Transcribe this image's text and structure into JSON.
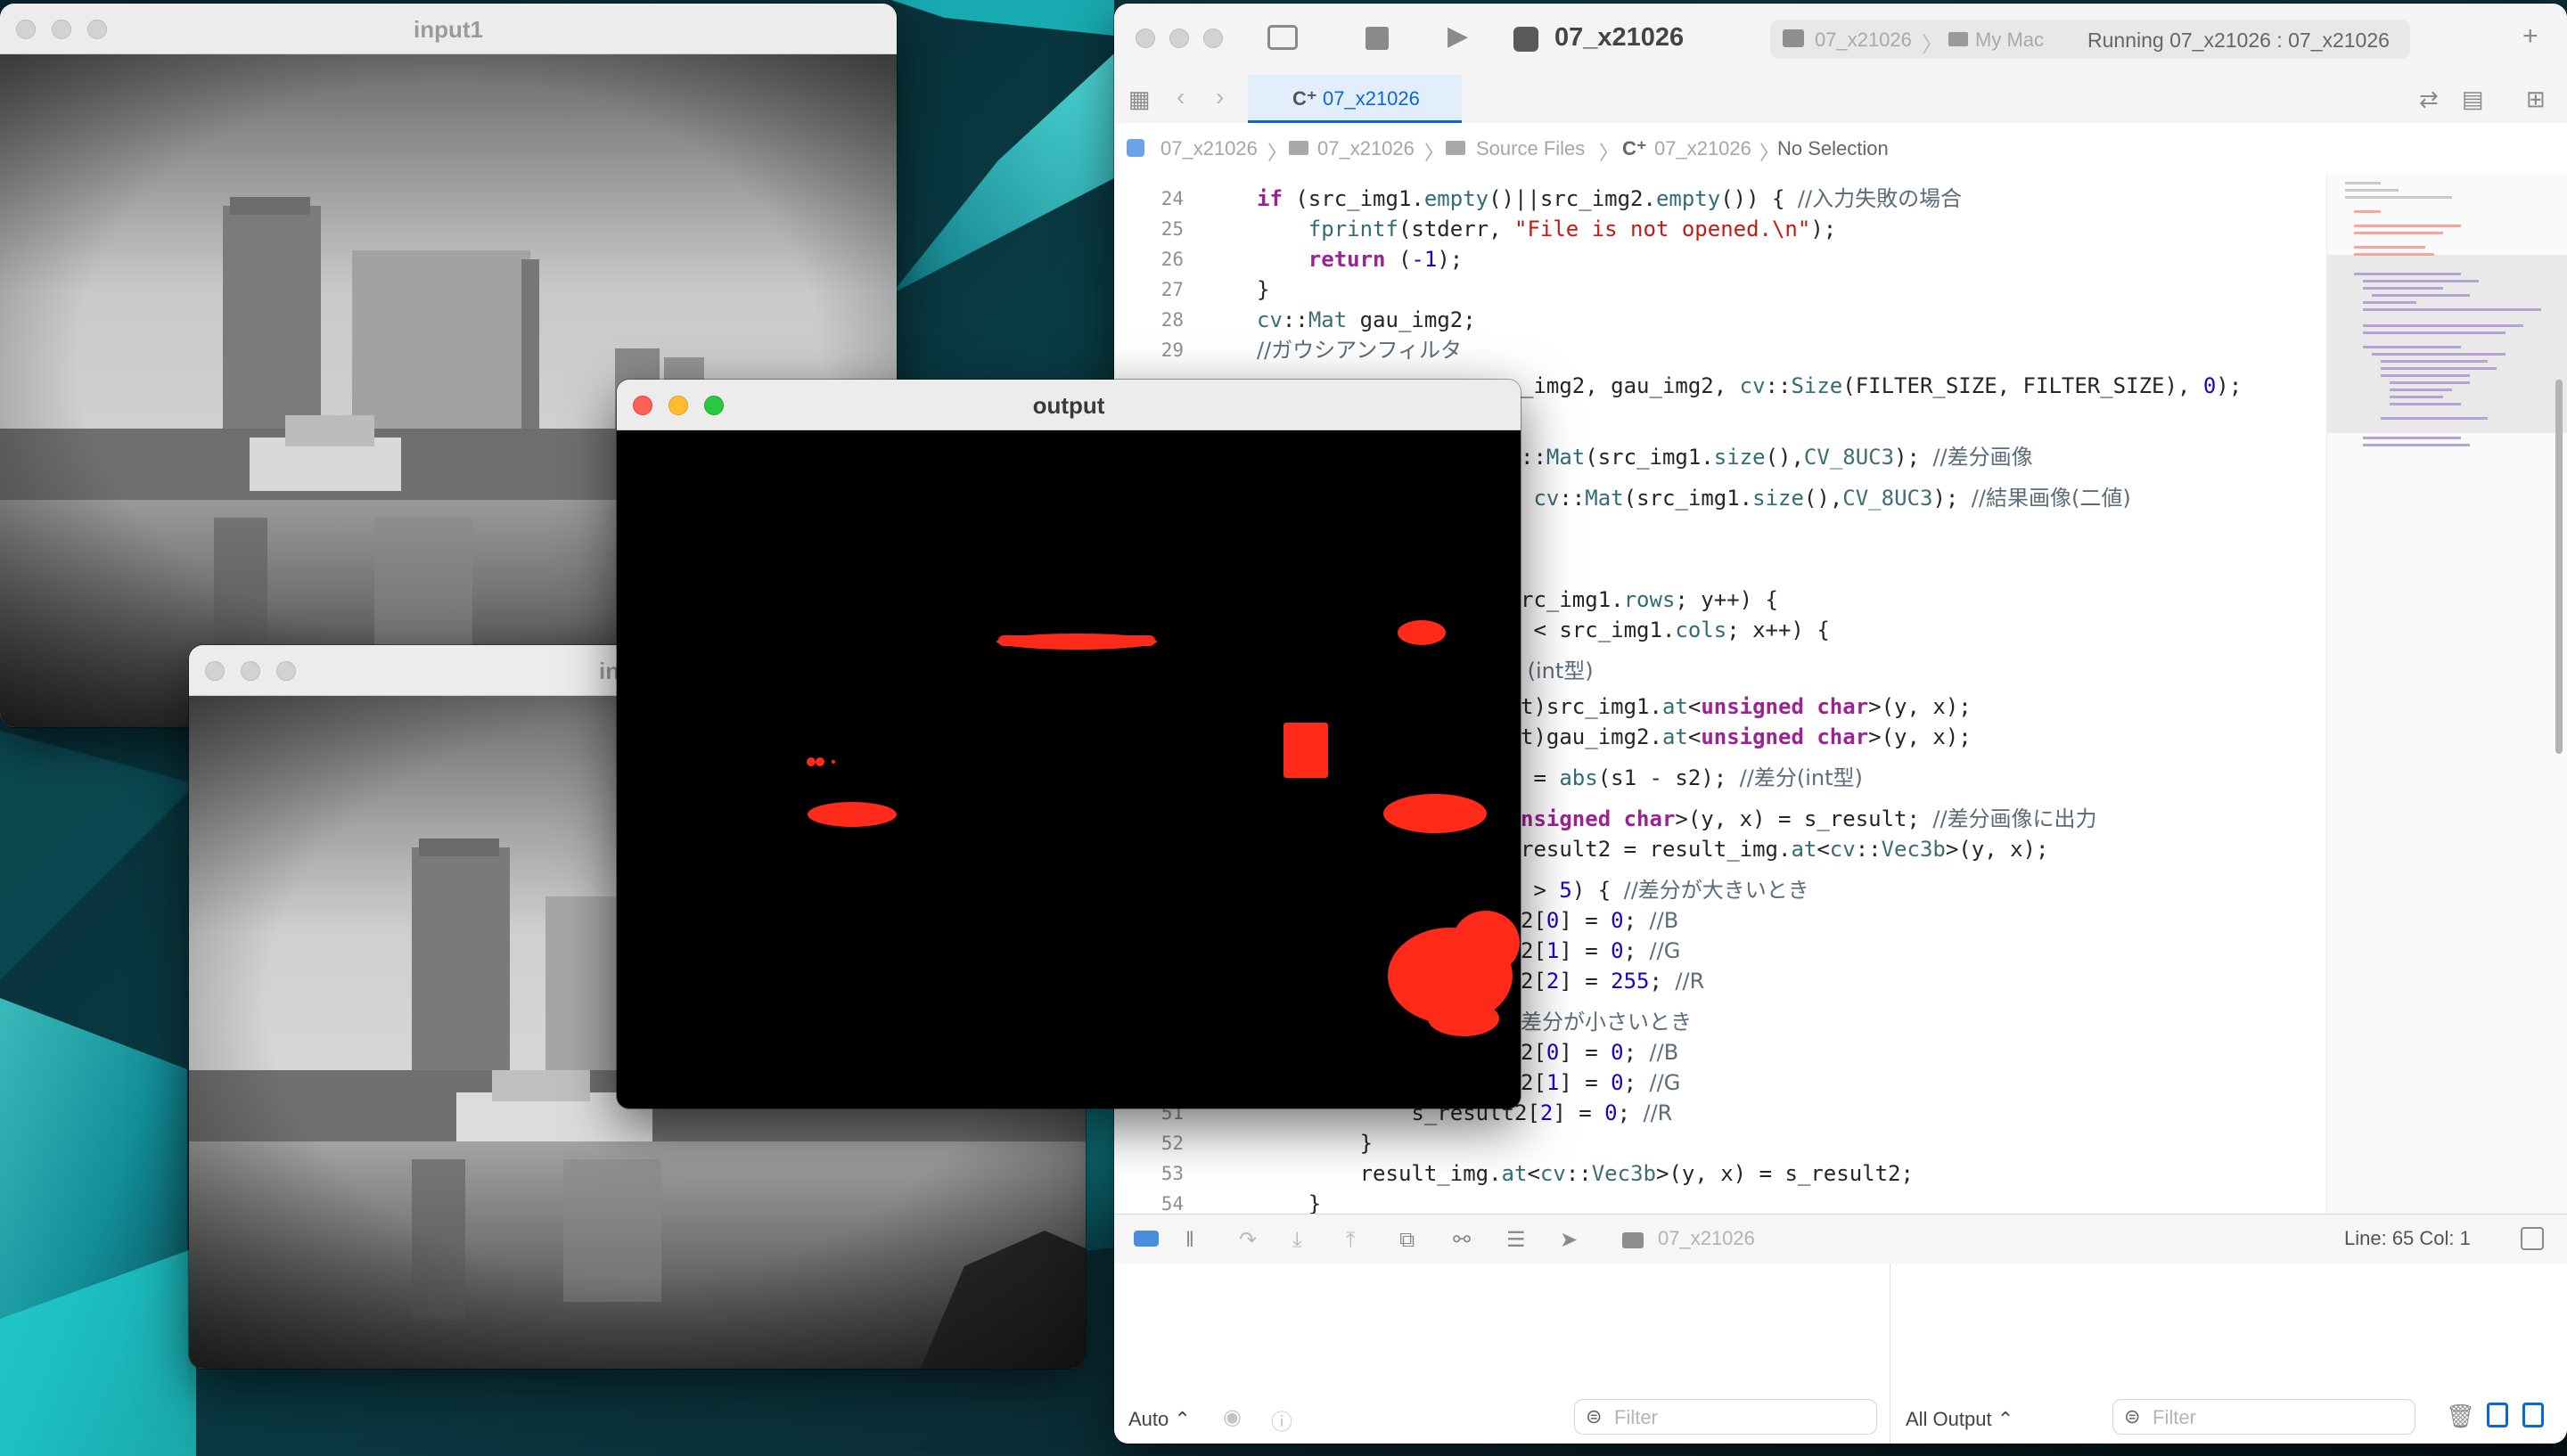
{
  "windows": {
    "input1": {
      "title": "input1"
    },
    "input2": {
      "title": "in"
    },
    "output": {
      "title": "output"
    }
  },
  "xcode": {
    "scheme_title": "07_x21026",
    "run_target": "07_x21026",
    "destination": "My Mac",
    "status": "Running 07_x21026 : 07_x21026",
    "tab_label": "07_x21026",
    "breadcrumb": [
      "07_x21026",
      "07_x21026",
      "Source Files",
      "07_x21026",
      "No Selection"
    ],
    "code": [
      {
        "n": "24",
        "t": "    if (src_img1.empty()||src_img2.empty()) { //入力失敗の場合"
      },
      {
        "n": "25",
        "t": "        fprintf(stderr, \"File is not opened.\\n\");"
      },
      {
        "n": "26",
        "t": "        return (-1);"
      },
      {
        "n": "27",
        "t": "    }"
      },
      {
        "n": "28",
        "t": "    cv::Mat gau_img2;"
      },
      {
        "n": "29",
        "t": "    //ガウシアンフィルタ"
      },
      {
        "n": "",
        "t": "_img2, gau_img2, cv::Size(FILTER_SIZE, FILTER_SIZE), 0);"
      },
      {
        "n": "",
        "t": "::Mat(src_img1.size(),CV_8UC3); //差分画像"
      },
      {
        "n": "",
        "t": " cv::Mat(src_img1.size(),CV_8UC3); //結果画像(二値)"
      },
      {
        "n": "",
        "t": "rc_img1.rows; y++) {"
      },
      {
        "n": "",
        "t": " < src_img1.cols; x++) {"
      },
      {
        "n": "",
        "t": " (int型)"
      },
      {
        "n": "",
        "t": "t)src_img1.at<unsigned char>(y, x);"
      },
      {
        "n": "",
        "t": "t)gau_img2.at<unsigned char>(y, x);"
      },
      {
        "n": "",
        "t": " = abs(s1 - s2); //差分(int型)"
      },
      {
        "n": "",
        "t": "nsigned char>(y, x) = s_result; //差分画像に出力"
      },
      {
        "n": "",
        "t": "result2 = result_img.at<cv::Vec3b>(y, x);"
      },
      {
        "n": "",
        "t": " > 5) { //差分が大きいとき"
      },
      {
        "n": "",
        "t": "2[0] = 0; //B"
      },
      {
        "n": "",
        "t": "2[1] = 0; //G"
      },
      {
        "n": "",
        "t": "2[2] = 255; //R"
      },
      {
        "n": "",
        "t": "差分が小さいとき"
      },
      {
        "n": "",
        "t": "2[0] = 0; //B"
      },
      {
        "n": "",
        "t": "2[1] = 0; //G"
      },
      {
        "n": "51",
        "t": "                s_result2[2] = 0; //R"
      },
      {
        "n": "52",
        "t": "            }"
      },
      {
        "n": "53",
        "t": "            result_img.at<cv::Vec3b>(y, x) = s_result2;"
      },
      {
        "n": "54",
        "t": "        }"
      }
    ],
    "debug_target": "07_x21026",
    "cursor_pos": "Line: 65  Col: 1",
    "console": {
      "auto_label": "Auto ⌃",
      "filter_placeholder": "Filter",
      "output_select": "All Output ⌃",
      "filter2_placeholder": "Filter"
    }
  },
  "colors": {
    "accent": "#0b67d6",
    "diff_red": "#ff2a1a"
  }
}
